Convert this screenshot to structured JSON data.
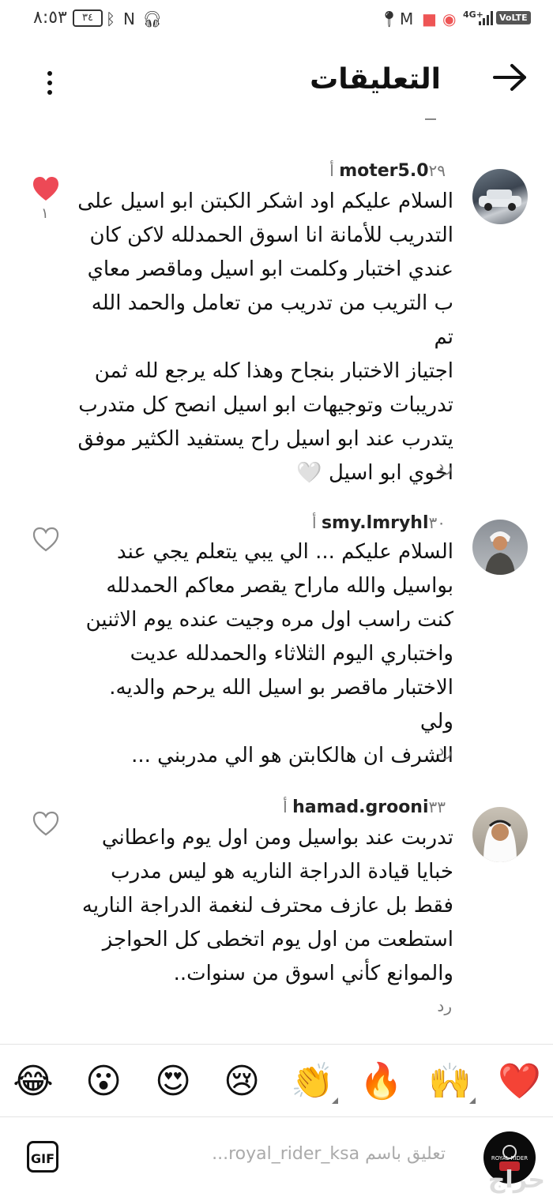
{
  "status_bar": {
    "time": "٨:٥٣",
    "battery": "٣٤",
    "network": "4G+",
    "volte": "VoLTE"
  },
  "header": {
    "title": "التعليقات",
    "back_icon": "arrow-right-icon",
    "more_icon": "more-vertical-icon"
  },
  "comments": [
    {
      "username": "moter5.0",
      "time": "٢٩ أ",
      "text_lines": [
        "السلام عليكم اود اشكر الكبتن ابو اسيل على",
        "التدريب للأمانة انا اسوق الحمدلله لاكن كان",
        "عندي اختبار وكلمت ابو اسيل وماقصر معاي",
        "ب التريب من تدريب من تعامل والحمد الله تم",
        "اجتياز الاختبار بنجاح وهذا كله يرجع لله ثمن",
        "تدريبات وتوجيهات ابو اسيل انصح كل متدرب",
        "يتدرب عند ابو اسيل راح يستفيد الكثير موفق",
        "اخوي ابو اسيل 🤍"
      ],
      "reply": "رد",
      "liked": true,
      "like_count": "١"
    },
    {
      "username": "smy.lmryhl",
      "time": "٣٠ أ",
      "text_lines": [
        "السلام عليكم ... الي يبي يتعلم يجي عند",
        "بواسيل والله ماراح يقصر معاكم الحمدلله",
        "كنت راسب اول مره وجيت عنده يوم الاثنين",
        "واختباري اليوم الثلاثاء والحمدلله عديت",
        "الاختبار ماقصر بو اسيل الله يرحم والديه. ولي",
        "الشرف ان هالكابتن هو الي مدربني ..."
      ],
      "reply": "رد",
      "liked": false,
      "like_count": ""
    },
    {
      "username": "hamad.grooni",
      "time": "٣٣ أ",
      "text_lines": [
        "تدربت عند بواسيل ومن اول يوم واعطاني",
        "خبايا قيادة الدراجة الناريه هو ليس مدرب",
        "فقط بل عازف محترف لنغمة الدراجة الناريه",
        "استطعت من اول يوم اتخطى كل الحواجز",
        "والموانع كأني اسوق من سنوات.."
      ],
      "reply": "رد",
      "liked": false,
      "like_count": ""
    }
  ],
  "emoji_bar": [
    "❤️",
    "🙌",
    "🔥",
    "👏",
    "😢",
    "😍",
    "😮",
    "😂"
  ],
  "input": {
    "placeholder": "تعليق باسم royal_rider_ksa...",
    "gif_label": "GIF",
    "avatar_text": "ROYAL RIDER"
  },
  "watermark": "حراج",
  "colors": {
    "like_red": "#ed4956",
    "muted": "#777777"
  }
}
